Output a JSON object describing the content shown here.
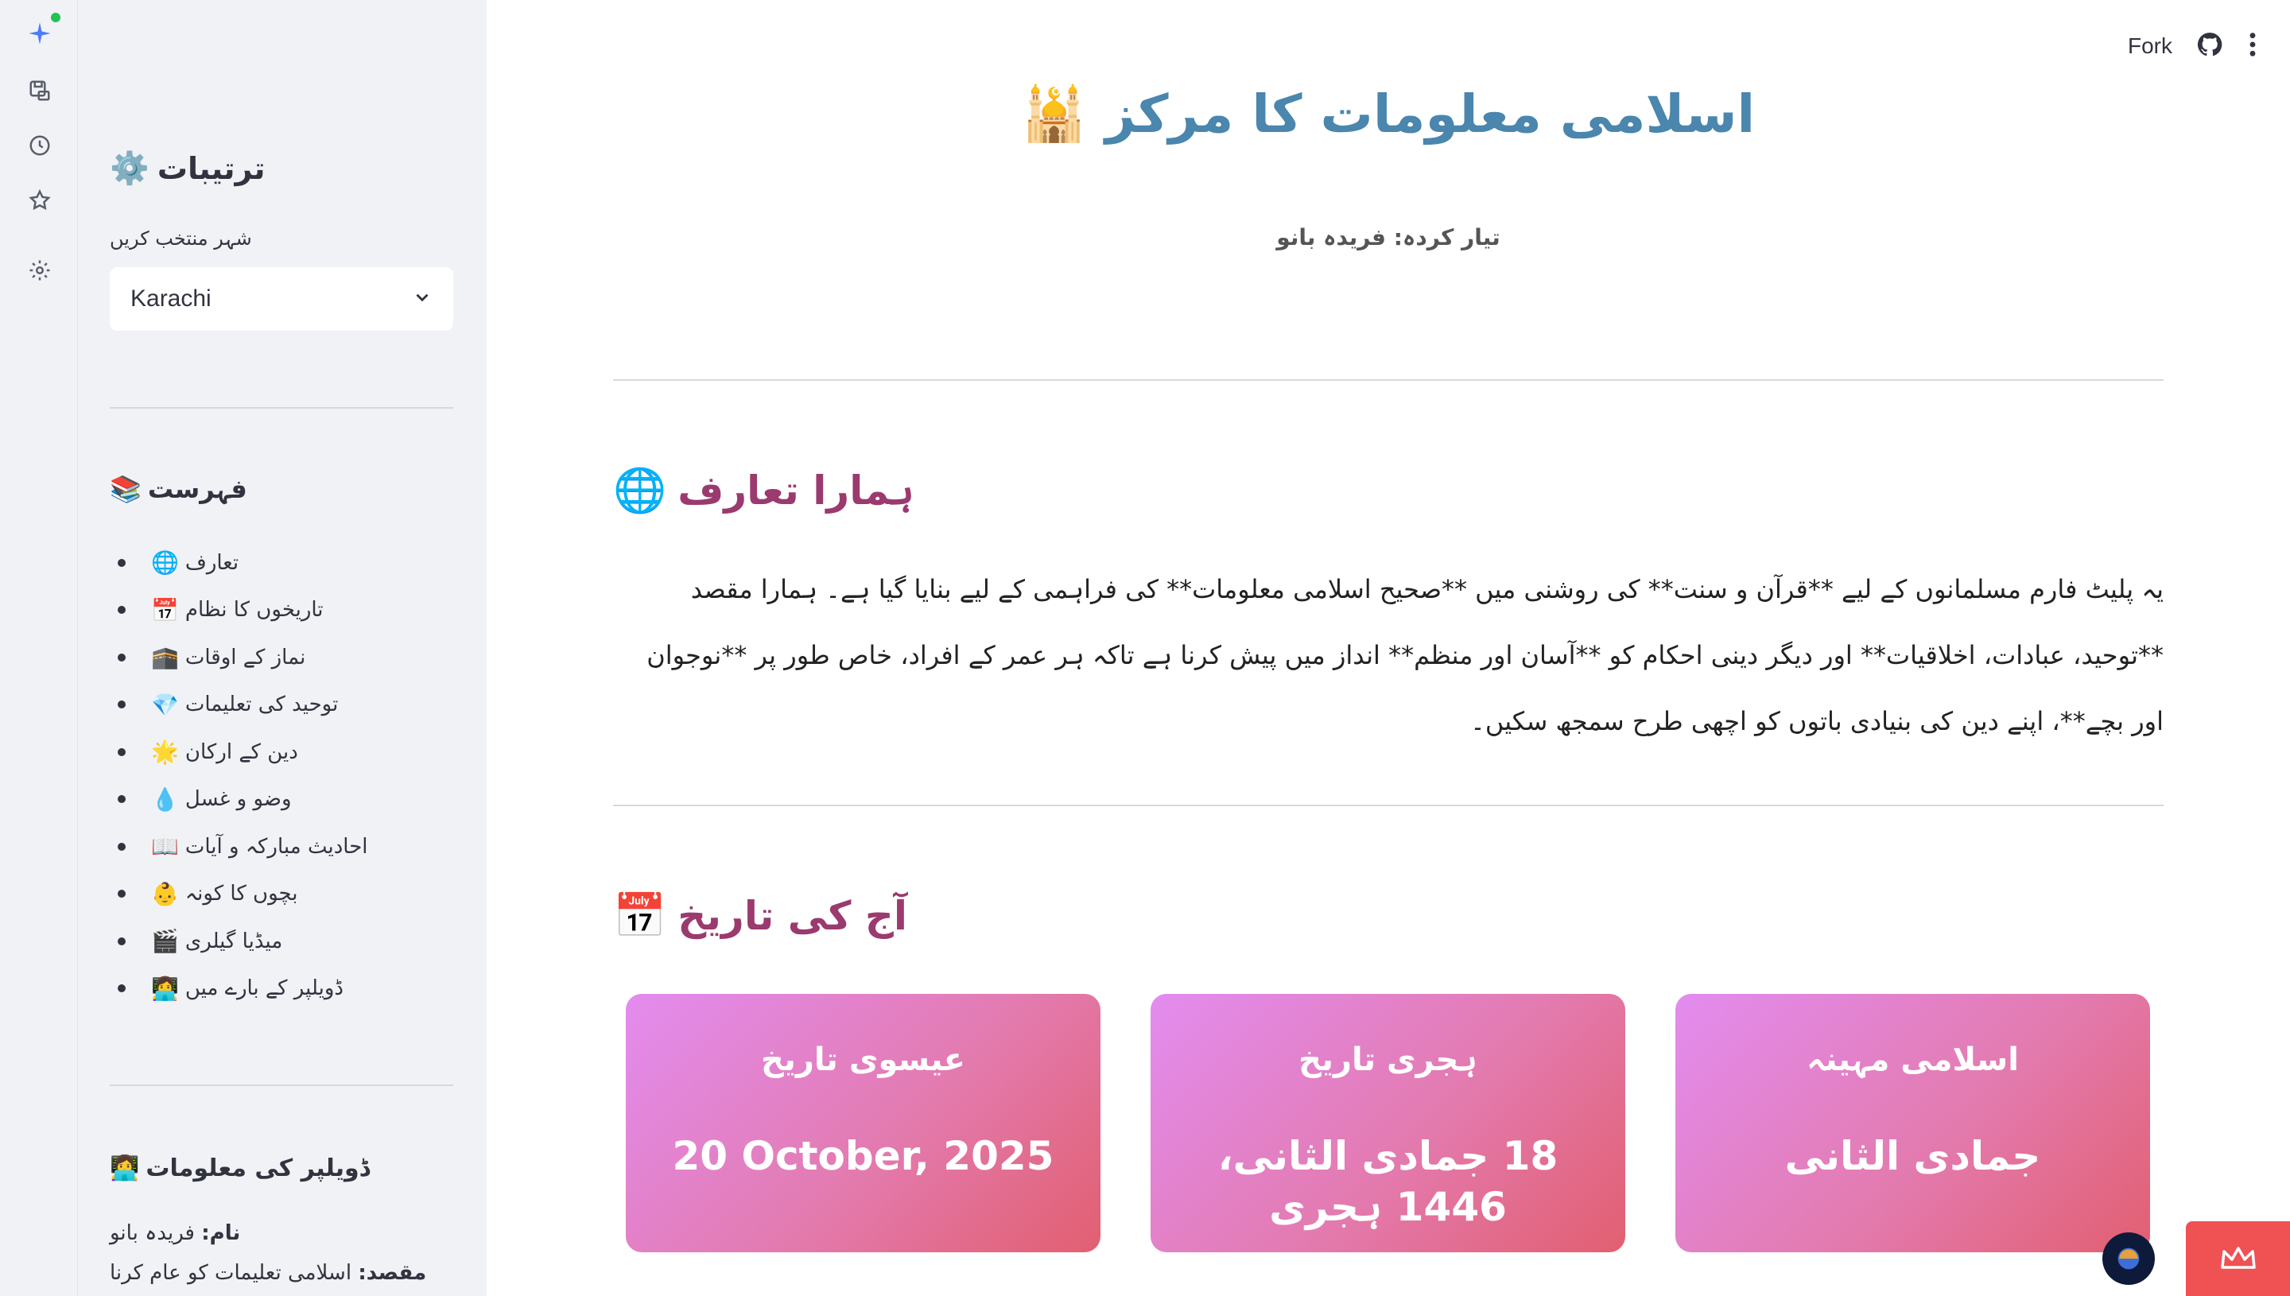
{
  "rail": {
    "icons": [
      "sparkle-icon",
      "save-icon",
      "history-icon",
      "star-icon",
      "settings-icon"
    ]
  },
  "sidebar": {
    "settings_title": "ترتیبات",
    "settings_emoji": "⚙️",
    "city_label": "شہر منتخب کریں",
    "city_value": "Karachi",
    "toc_title": "فہرست",
    "toc_emoji": "📚",
    "toc_items": [
      {
        "label": "تعارف",
        "emoji": "🌐"
      },
      {
        "label": "تاریخوں کا نظام",
        "emoji": "📅"
      },
      {
        "label": "نماز کے اوقات",
        "emoji": "🕋"
      },
      {
        "label": "توحید کی تعلیمات",
        "emoji": "💎"
      },
      {
        "label": "دین کے ارکان",
        "emoji": "🌟"
      },
      {
        "label": "وضو و غسل",
        "emoji": "💧"
      },
      {
        "label": "احادیث مبارکہ و آیات",
        "emoji": "📖"
      },
      {
        "label": "بچوں کا کونہ",
        "emoji": "👶"
      },
      {
        "label": "میڈیا گیلری",
        "emoji": "🎬"
      },
      {
        "label": "ڈویلپر کے بارے میں",
        "emoji": "👩‍💻"
      }
    ],
    "dev_title": "ڈویلپر کی معلومات",
    "dev_emoji": "👩‍💻",
    "dev_name_key": "نام:",
    "dev_name_val": "فریدہ بانو",
    "dev_goal_key": "مقصد:",
    "dev_goal_val": "اسلامی تعلیمات کو عام کرنا"
  },
  "header": {
    "fork_label": "Fork"
  },
  "main": {
    "title": "اسلامی معلومات کا مرکز",
    "title_emoji": "🕌",
    "author": "تیار کردہ: فریدہ بانو",
    "intro_heading": "ہمارا تعارف",
    "intro_emoji": "🌐",
    "intro_text": "یہ پلیٹ فارم مسلمانوں کے لیے **قرآن و سنت** کی روشنی میں **صحیح اسلامی معلومات** کی فراہمی کے لیے بنایا گیا ہے۔ ہمارا مقصد **توحید، عبادات، اخلاقیات** اور دیگر دینی احکام کو **آسان اور منظم** انداز میں پیش کرنا ہے تاکہ ہر عمر کے افراد، خاص طور پر **نوجوان اور بچے**، اپنے دین کی بنیادی باتوں کو اچھی طرح سمجھ سکیں۔",
    "date_heading": "آج کی تاریخ",
    "date_emoji": "📅",
    "cards": [
      {
        "title": "عیسوی تاریخ",
        "value": "20 October, 2025"
      },
      {
        "title": "ہجری تاریخ",
        "value": "18 جمادی الثانی، 1446 ہجری"
      },
      {
        "title": "اسلامی مہینہ",
        "value": "جمادی الثانی"
      }
    ]
  }
}
